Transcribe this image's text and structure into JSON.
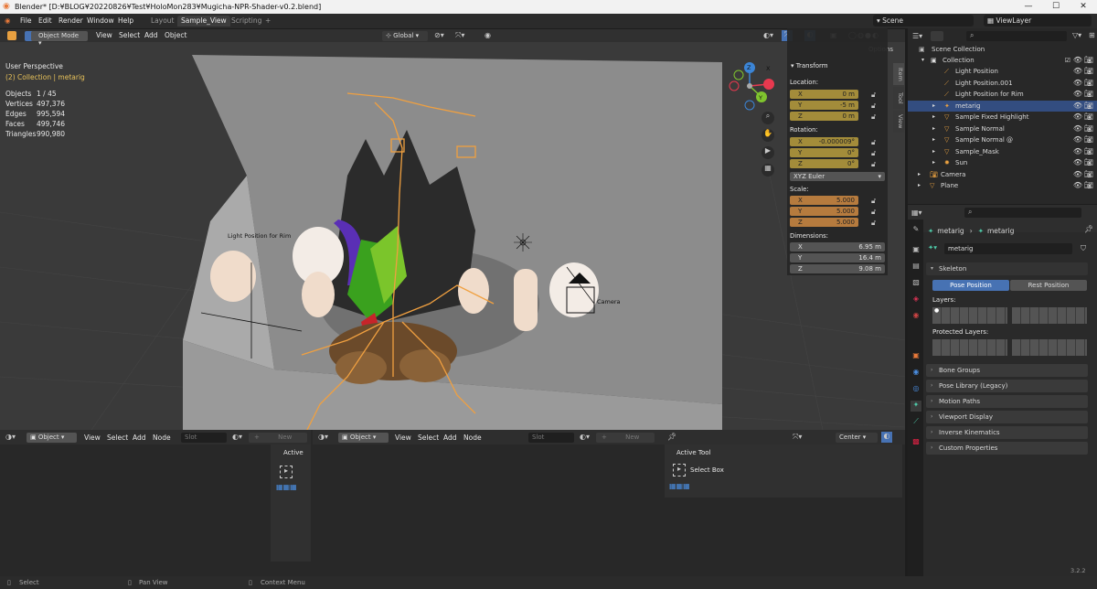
{
  "window": {
    "title": "Blender* [D:¥BLOG¥20220826¥Test¥HoloMon283¥Mugicha-NPR-Shader-v0.2.blend]",
    "controls": [
      "—",
      "☐",
      "✕"
    ]
  },
  "menu": {
    "items": [
      "File",
      "Edit",
      "Render",
      "Window",
      "Help"
    ],
    "workspaces": [
      "Layout",
      "Sample_View",
      "Scripting",
      "+"
    ],
    "scene_label": "Scene",
    "viewlayer_label": "ViewLayer"
  },
  "viewport": {
    "mode": "Object Mode",
    "menus": [
      "View",
      "Select",
      "Add",
      "Object"
    ],
    "orientation": "Global",
    "options_label": "Options",
    "overlay_title": "User Perspective",
    "overlay_subtitle": "(2) Collection | metarig",
    "stats": [
      {
        "label": "Objects",
        "value": "1 / 45"
      },
      {
        "label": "Vertices",
        "value": "497,376"
      },
      {
        "label": "Edges",
        "value": "995,594"
      },
      {
        "label": "Faces",
        "value": "499,746"
      },
      {
        "label": "Triangles",
        "value": "990,980"
      }
    ],
    "scene_labels": {
      "light_rim": "Light Position for Rim",
      "camera": "Camera"
    },
    "gizmo_axes": {
      "x": "X",
      "y": "Y",
      "z": "Z"
    },
    "gizmo_colors": {
      "x": "#e8394f",
      "y": "#7fc42e",
      "z": "#3c85d6"
    }
  },
  "npanel": {
    "tabs": [
      "Item",
      "Tool",
      "View"
    ],
    "title": "Transform",
    "location_label": "Location:",
    "location": [
      {
        "axis": "X",
        "value": "0 m"
      },
      {
        "axis": "Y",
        "value": "-5 m"
      },
      {
        "axis": "Z",
        "value": "0 m"
      }
    ],
    "rotation_label": "Rotation:",
    "rotation": [
      {
        "axis": "X",
        "value": "-0.000009°"
      },
      {
        "axis": "Y",
        "value": "0°"
      },
      {
        "axis": "Z",
        "value": "0°"
      }
    ],
    "rotation_mode": "XYZ Euler",
    "scale_label": "Scale:",
    "scale": [
      {
        "axis": "X",
        "value": "5.000"
      },
      {
        "axis": "Y",
        "value": "5.000"
      },
      {
        "axis": "Z",
        "value": "5.000"
      }
    ],
    "dimensions_label": "Dimensions:",
    "dimensions": [
      {
        "axis": "X",
        "value": "6.95 m"
      },
      {
        "axis": "Y",
        "value": "16.4 m"
      },
      {
        "axis": "Z",
        "value": "9.08 m"
      }
    ]
  },
  "outliner": {
    "root": "Scene Collection",
    "collection": "Collection",
    "rows": [
      {
        "name": "Light Position",
        "indent": 2,
        "icon": "bone",
        "selected": false
      },
      {
        "name": "Light Position.001",
        "indent": 2,
        "icon": "bone",
        "selected": false
      },
      {
        "name": "Light Position for Rim",
        "indent": 2,
        "icon": "bone",
        "selected": false
      },
      {
        "name": "metarig",
        "indent": 2,
        "icon": "armature",
        "selected": true
      },
      {
        "name": "Sample Fixed Highlight",
        "indent": 2,
        "icon": "mesh",
        "selected": false
      },
      {
        "name": "Sample Normal",
        "indent": 2,
        "icon": "mesh",
        "selected": false
      },
      {
        "name": "Sample Normal @",
        "indent": 2,
        "icon": "mesh",
        "selected": false
      },
      {
        "name": "Sample_Mask",
        "indent": 2,
        "icon": "mesh",
        "selected": false
      },
      {
        "name": "Sun",
        "indent": 2,
        "icon": "light",
        "selected": false
      },
      {
        "name": "Camera",
        "indent": 1,
        "icon": "camera",
        "selected": false
      },
      {
        "name": "Plane",
        "indent": 1,
        "icon": "mesh",
        "selected": false
      }
    ]
  },
  "properties": {
    "breadcrumb": [
      "metarig",
      "metarig"
    ],
    "data_name": "metarig",
    "skeleton_label": "Skeleton",
    "pose_position": "Pose Position",
    "rest_position": "Rest Position",
    "layers_label": "Layers:",
    "protected_layers_label": "Protected Layers:",
    "panels": [
      "Bone Groups",
      "Pose Library (Legacy)",
      "Motion Paths",
      "Viewport Display",
      "Inverse Kinematics",
      "Custom Properties"
    ]
  },
  "lower": {
    "left": {
      "mode": "Object",
      "menus": [
        "View",
        "Select",
        "Add",
        "Node"
      ],
      "slot": "Slot",
      "new_label": "New"
    },
    "right": {
      "mode": "Object",
      "menus": [
        "View",
        "Select",
        "Add",
        "Node"
      ],
      "slot": "Slot",
      "new_label": "New",
      "pivot": "Center"
    },
    "active_panel_label": "Active",
    "active_tool_label": "Active Tool",
    "select_box_label": "Select Box"
  },
  "status": {
    "items": [
      "Select",
      "Pan View",
      "Context Menu"
    ],
    "version": "3.2.2"
  }
}
